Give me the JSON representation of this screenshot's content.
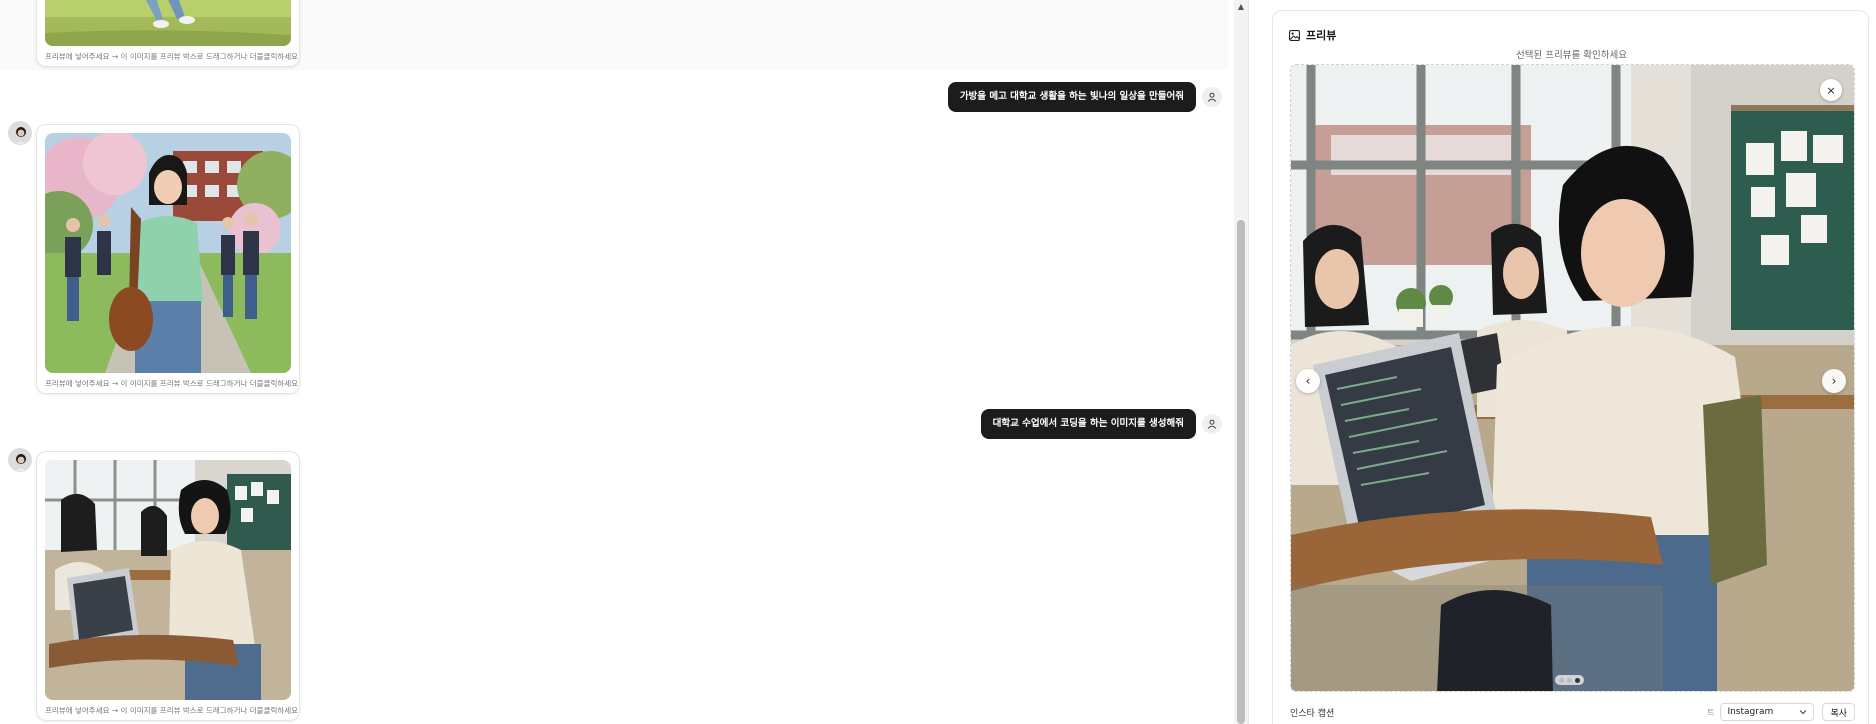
{
  "chat": {
    "image_hint": "프리뷰에 넣어주세요 → 이 이미지를 프리뷰 박스로 드래그하거나 더블클릭하세요",
    "messages": [
      {
        "role": "user",
        "text": "가방을 메고 대학교 생활을 하는 빛나의 일상을 만들어줘"
      },
      {
        "role": "user",
        "text": "대학교 수업에서 코딩을 하는 이미지를 생성해줘"
      }
    ]
  },
  "preview": {
    "title": "프리뷰",
    "subtitle": "선택된 프리뷰를 확인하세요",
    "close_icon": "×",
    "prev_icon": "‹",
    "next_icon": "›",
    "slides_total": 3,
    "slide_active": 3
  },
  "caption": {
    "label": "인스타 캡션",
    "mark": "트",
    "platform": "Instagram",
    "copy_label": "복사"
  },
  "colors": {
    "bubble": "#1c1c1c",
    "accent": "#2d5a4a"
  }
}
